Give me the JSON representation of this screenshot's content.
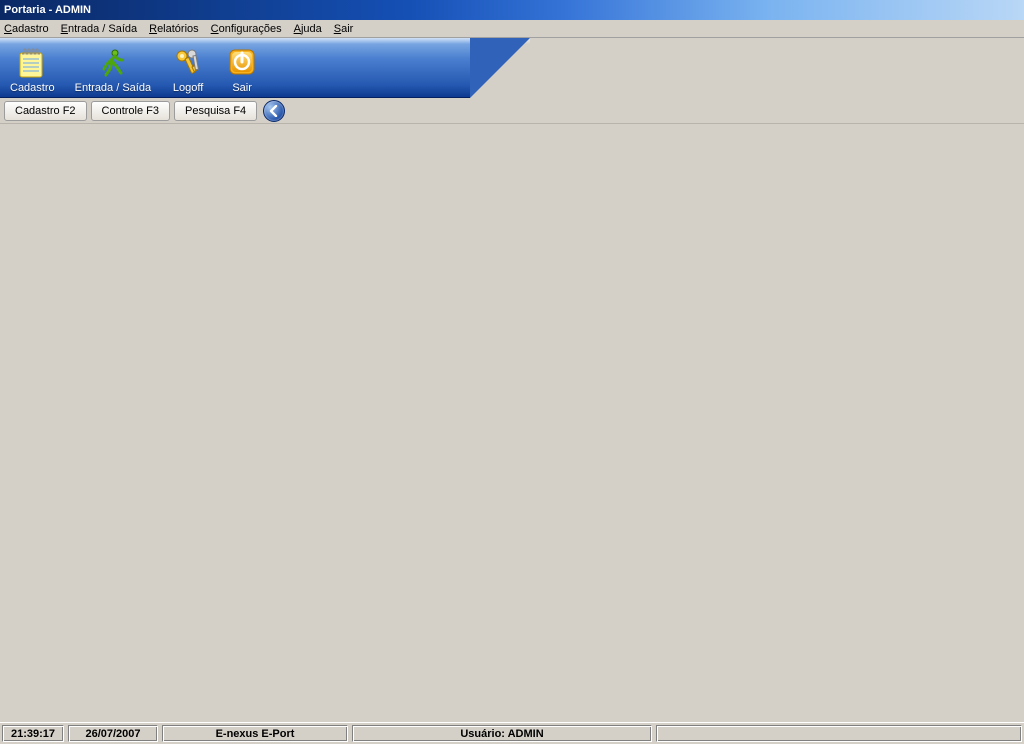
{
  "title": "Portaria - ADMIN",
  "menu": {
    "cadastro": "Cadastro",
    "entrada_saida": "Entrada / Saída",
    "relatorios": "Relatórios",
    "configuracoes": "Configurações",
    "ajuda": "Ajuda",
    "sair": "Sair"
  },
  "toolbar": {
    "cadastro": "Cadastro",
    "entrada_saida": "Entrada / Saída",
    "logoff": "Logoff",
    "sair": "Sair"
  },
  "tabs": {
    "cadastro": "Cadastro F2",
    "controle": "Controle F3",
    "pesquisa": "Pesquisa F4"
  },
  "status": {
    "time": "21:39:17",
    "date": "26/07/2007",
    "app": "E-nexus E-Port",
    "user_label": "Usuário: ADMIN"
  }
}
